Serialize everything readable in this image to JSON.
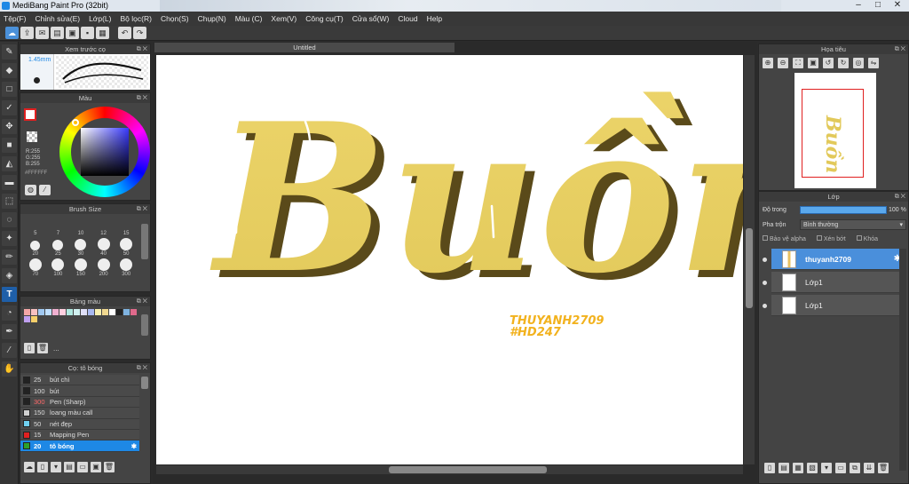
{
  "window": {
    "title": "MediBang Paint Pro (32bit)"
  },
  "menu": [
    "Tệp(F)",
    "Chỉnh sửa(E)",
    "Lớp(L)",
    "Bộ lọc(R)",
    "Chọn(S)",
    "Chụp(N)",
    "Màu (C)",
    "Xem(V)",
    "Công cụ(T)",
    "Cửa sổ(W)",
    "Cloud",
    "Help"
  ],
  "panels": {
    "brush_preview": {
      "title": "Xem trước cọ",
      "size": "1.45mm"
    },
    "color": {
      "title": "Màu",
      "r": "R:255",
      "g": "G:255",
      "b": "B:255",
      "hex": "#FFFFFF"
    },
    "brush_size": {
      "title": "Brush Size",
      "labels": [
        "5",
        "7",
        "10",
        "12",
        "15",
        "20",
        "25",
        "30",
        "40",
        "50",
        "70",
        "100",
        "150",
        "200",
        "300"
      ],
      "top_labels": [
        "5",
        "7",
        "10",
        "12",
        "15"
      ]
    },
    "palette": {
      "title": "Bảng màu",
      "more": "..."
    },
    "brushes": {
      "title": "Cọ: tô bóng",
      "items": [
        {
          "size": "25",
          "name": "bút chì",
          "color": "#222222"
        },
        {
          "size": "100",
          "name": "bút",
          "color": "#222222"
        },
        {
          "size": "300",
          "name": "Pen (Sharp)",
          "color": "#222222",
          "red": true
        },
        {
          "size": "150",
          "name": "loang màu call",
          "color": "#d0d0d0"
        },
        {
          "size": "50",
          "name": "nét đẹp",
          "color": "#6fd0f0"
        },
        {
          "size": "15",
          "name": "Mapping Pen",
          "color": "#e02020"
        },
        {
          "size": "20",
          "name": "tô bóng",
          "color": "#2ca02c",
          "selected": true
        }
      ]
    },
    "navigator": {
      "title": "Họa tiêu"
    },
    "layer": {
      "title": "Lớp",
      "opacity_label": "Độ trong",
      "opacity_value": "100 %",
      "blend_label": "Pha trộn",
      "blend_value": "Bình thường",
      "opt_alpha": "Bảo vệ alpha",
      "opt_clip": "Xén bớt",
      "opt_lock": "Khóa",
      "items": [
        {
          "name": "thuyanh2709",
          "selected": true
        },
        {
          "name": "Lớp1"
        },
        {
          "name": "Lớp1"
        }
      ]
    }
  },
  "document": {
    "tab": "Untitled",
    "art_text": "Buồn",
    "signature_line1": "THUYANH2709",
    "signature_line2": "#HD247"
  },
  "colors": {
    "accent": "#1e88e5",
    "art_yellow": "#e8cf5f",
    "art_shadow": "#5a4a1a",
    "signature": "#f2b21e"
  }
}
